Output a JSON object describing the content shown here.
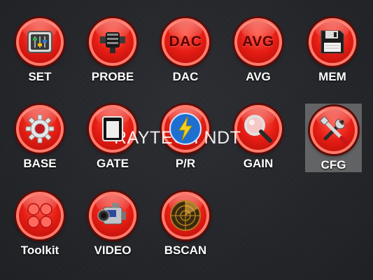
{
  "menu": {
    "set": {
      "label": "SET",
      "icon": "sliders-icon"
    },
    "probe": {
      "label": "PROBE",
      "icon": "probe-icon"
    },
    "dac": {
      "label": "DAC",
      "icon_text": "DAC"
    },
    "avg": {
      "label": "AVG",
      "icon_text": "AVG"
    },
    "mem": {
      "label": "MEM",
      "icon": "floppy-disk-icon"
    },
    "base": {
      "label": "BASE",
      "icon": "gear-icon"
    },
    "gate": {
      "label": "GATE",
      "icon": "gate-icon"
    },
    "pr": {
      "label": "P/R",
      "icon": "lightning-icon"
    },
    "gain": {
      "label": "GAIN",
      "icon": "magnifier-icon"
    },
    "cfg": {
      "label": "CFG",
      "icon": "tools-icon",
      "selected": true
    },
    "toolkit": {
      "label": "Toolkit",
      "icon": "dots-grid-icon"
    },
    "video": {
      "label": "VIDEO",
      "icon": "camcorder-icon"
    },
    "bscan": {
      "label": "BSCAN",
      "icon": "radar-icon"
    }
  },
  "watermark": "RAYTECH NDT",
  "colors": {
    "button_red": "#e51d14",
    "selection_gray": "#8a8a8a",
    "label_white": "#ffffff"
  }
}
